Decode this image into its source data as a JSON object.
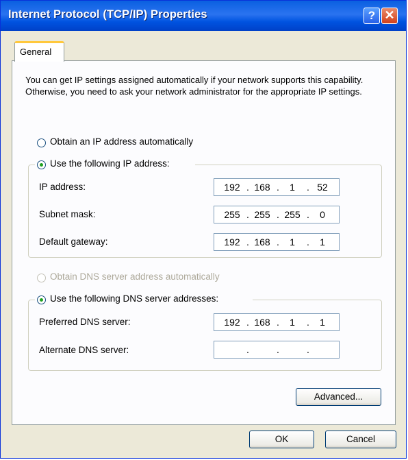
{
  "window": {
    "title": "Internet Protocol (TCP/IP) Properties",
    "help_glyph": "?",
    "close_glyph": "✕"
  },
  "tabs": [
    {
      "label": "General"
    }
  ],
  "intro_text": "You can get IP settings assigned automatically if your network supports this capability. Otherwise, you need to ask your network administrator for the appropriate IP settings.",
  "ip_section": {
    "auto_label": "Obtain an IP address automatically",
    "manual_label": "Use the following IP address:",
    "selected": "manual",
    "fields": [
      {
        "label": "IP address:",
        "octets": [
          "192",
          "168",
          "1",
          "52"
        ]
      },
      {
        "label": "Subnet mask:",
        "octets": [
          "255",
          "255",
          "255",
          "0"
        ]
      },
      {
        "label": "Default gateway:",
        "octets": [
          "192",
          "168",
          "1",
          "1"
        ]
      }
    ]
  },
  "dns_section": {
    "auto_label": "Obtain DNS server address automatically",
    "manual_label": "Use the following DNS server addresses:",
    "selected": "manual",
    "auto_enabled": false,
    "fields": [
      {
        "label": "Preferred DNS server:",
        "octets": [
          "192",
          "168",
          "1",
          "1"
        ]
      },
      {
        "label": "Alternate DNS server:",
        "octets": [
          "",
          "",
          "",
          ""
        ]
      }
    ]
  },
  "buttons": {
    "advanced": "Advanced...",
    "ok": "OK",
    "cancel": "Cancel"
  }
}
